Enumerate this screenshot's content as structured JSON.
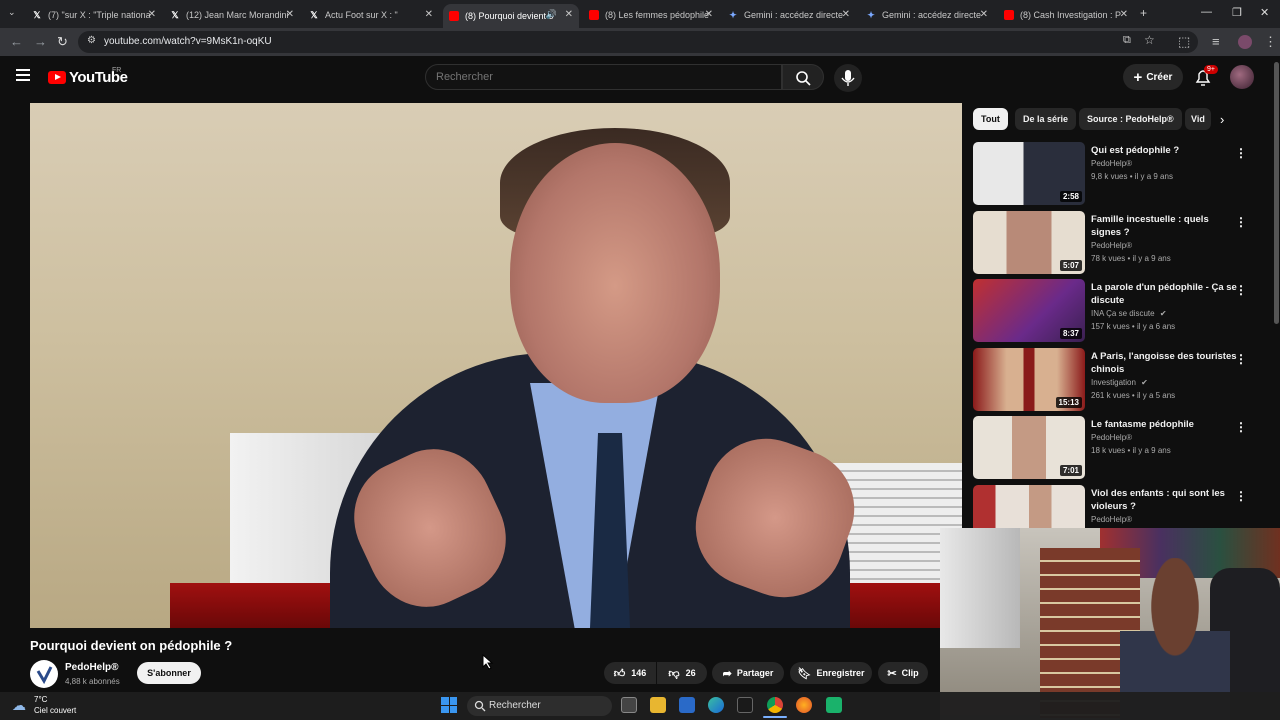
{
  "browser": {
    "tabs": [
      {
        "title": "(7) \"sur X : \"Triple nationa",
        "site": "x"
      },
      {
        "title": "(12) Jean Marc Morandini",
        "site": "x"
      },
      {
        "title": "Actu Foot sur X : \"",
        "site": "x"
      },
      {
        "title": "(8) Pourquoi devient o",
        "site": "youtube",
        "active": true
      },
      {
        "title": "(8) Les femmes pédophile",
        "site": "youtube"
      },
      {
        "title": "Gemini : accédez directe",
        "site": "gemini"
      },
      {
        "title": "Gemini : accédez directe",
        "site": "gemini"
      },
      {
        "title": "(8) Cash Investigation : P",
        "site": "youtube"
      }
    ],
    "url": "youtube.com/watch?v=9MsK1n-oqKU"
  },
  "youtube": {
    "logo_text": "YouTube",
    "country_code": "FR",
    "search_placeholder": "Rechercher",
    "create_label": "Créer",
    "notification_count": "9+",
    "video": {
      "title": "Pourquoi devient on pédophile ?",
      "channel": "PedoHelp®",
      "subscribers": "4,88 k abonnés",
      "subscribe_label": "S'abonner",
      "likes": "146",
      "dislikes": "26",
      "share_label": "Partager",
      "save_label": "Enregistrer",
      "clip_label": "Clip"
    },
    "chips": [
      "Tout",
      "De la série",
      "Source : PedoHelp®",
      "Vid"
    ],
    "recommendations": [
      {
        "title": "Qui est pédophile ?",
        "channel": "PedoHelp®",
        "meta": "9,8 k vues • il y a 9 ans",
        "duration": "2:58"
      },
      {
        "title": "Famille incestuelle : quels signes ?",
        "channel": "PedoHelp®",
        "meta": "78 k vues • il y a 9 ans",
        "duration": "5:07"
      },
      {
        "title": "La parole d'un pédophile - Ça se discute",
        "channel": "INA Ça se discute",
        "meta": "157 k vues • il y a 6 ans",
        "duration": "8:37",
        "verified": true
      },
      {
        "title": "A Paris, l'angoisse des touristes chinois",
        "channel": "Investigation",
        "meta": "261 k vues • il y a 5 ans",
        "duration": "15:13",
        "verified": true
      },
      {
        "title": "Le fantasme pédophile",
        "channel": "PedoHelp®",
        "meta": "18 k vues • il y a 9 ans",
        "duration": "7:01"
      },
      {
        "title": "Viol des enfants : qui sont les violeurs ?",
        "channel": "PedoHelp®",
        "meta": "",
        "duration": ""
      }
    ]
  },
  "taskbar": {
    "weather_temp": "7°C",
    "weather_desc": "Ciel couvert",
    "search_label": "Rechercher"
  },
  "colors": {
    "youtube_red": "#ff0000",
    "background": "#0f0f0f",
    "chip_bg": "#272727"
  }
}
